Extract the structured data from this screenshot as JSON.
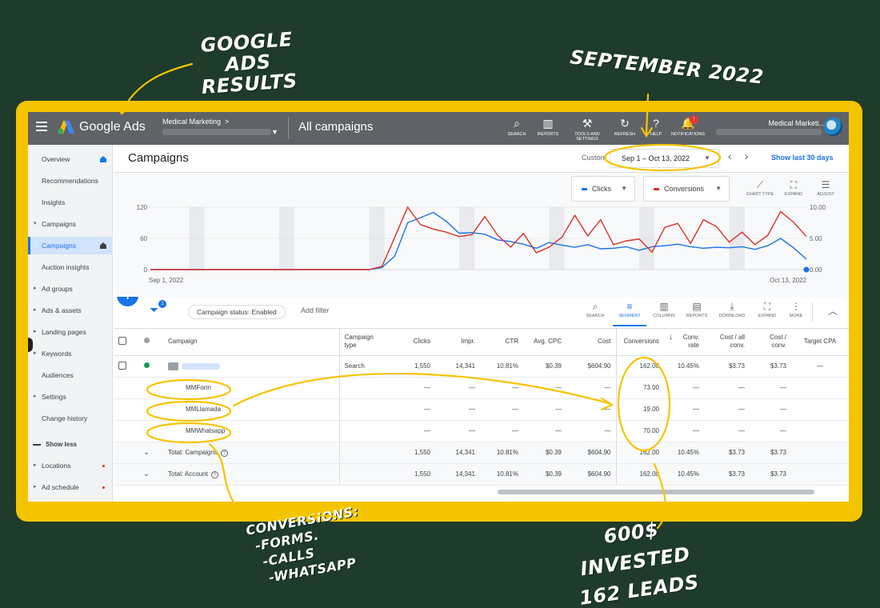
{
  "annotations": {
    "google_ads_results": [
      "GOOGLE ADS",
      "RESULTS"
    ],
    "september": "SEPTEMBER 2022",
    "conversions": [
      "CONVERSIONS:",
      "-FORMS.",
      "-CALLS",
      "-WHATSAPP"
    ],
    "invested": [
      "600$ INVESTED",
      "162 LEADS"
    ],
    "highlight_color": "#f5c400"
  },
  "topbar": {
    "brand": "Google Ads",
    "account": "Medical Marketing",
    "account_chevron": ">",
    "page": "All campaigns",
    "tools": [
      {
        "icon": "search-icon",
        "glyph": "⌕",
        "label": "SEARCH"
      },
      {
        "icon": "reports-icon",
        "glyph": "▥",
        "label": "REPORTS"
      },
      {
        "icon": "wrench-icon",
        "glyph": "⚒",
        "label": "TOOLS AND SETTINGS"
      },
      {
        "icon": "refresh-icon",
        "glyph": "↻",
        "label": "REFRESH"
      },
      {
        "icon": "help-icon",
        "glyph": "?",
        "label": "HELP"
      },
      {
        "icon": "bell-icon",
        "glyph": "🔔",
        "label": "NOTIFICATIONS"
      }
    ],
    "notification_count": "!",
    "user": "Medical Marketi..."
  },
  "sidebar": {
    "items": [
      {
        "label": "Overview",
        "style": "home"
      },
      {
        "label": "Recommendations",
        "style": ""
      },
      {
        "label": "Insights",
        "style": ""
      },
      {
        "label": "Campaigns",
        "style": "open"
      },
      {
        "label": "Campaigns",
        "style": "active"
      },
      {
        "label": "Auction insights",
        "style": ""
      },
      {
        "label": "Ad groups",
        "style": "arrow"
      },
      {
        "label": "Ads & assets",
        "style": "arrow"
      },
      {
        "label": "Landing pages",
        "style": "arrow"
      },
      {
        "label": "Keywords",
        "style": "arrow"
      },
      {
        "label": "Audiences",
        "style": ""
      },
      {
        "label": "Settings",
        "style": "arrow"
      },
      {
        "label": "Change history",
        "style": ""
      }
    ],
    "show_less": "Show less",
    "more_items": [
      {
        "label": "Locations",
        "style": "arrow"
      },
      {
        "label": "Ad schedule",
        "style": "arrow"
      }
    ]
  },
  "header": {
    "title": "Campaigns",
    "custom_label": "Custom",
    "date_range": "Sep 1 – Oct 13, 2022",
    "show_last": "Show last 30 days"
  },
  "chart": {
    "metric1": {
      "label": "Clicks",
      "color": "#1a73e8"
    },
    "metric2": {
      "label": "Conversions",
      "color": "#d93025"
    },
    "tools": [
      {
        "icon": "chart-type-icon",
        "glyph": "⟋",
        "label": "CHART TYPE"
      },
      {
        "icon": "expand-icon",
        "glyph": "⛶",
        "label": "EXPAND"
      },
      {
        "icon": "adjust-icon",
        "glyph": "☰",
        "label": "ADJUST"
      }
    ]
  },
  "chart_data": {
    "type": "line",
    "x_start": "Sep 1, 2022",
    "x_end": "Oct 13, 2022",
    "y_left_ticks": [
      "120",
      "60",
      "0"
    ],
    "y_right_ticks": [
      "10.00",
      "5.00",
      "0.00"
    ],
    "ylim_left": [
      0,
      120
    ],
    "ylim_right": [
      0,
      10
    ],
    "series": [
      {
        "name": "Clicks",
        "axis": "left",
        "color": "#1a73e8",
        "values": [
          0,
          0,
          0,
          0,
          0,
          0,
          0,
          0,
          0,
          0,
          0,
          0,
          0,
          0,
          0,
          0,
          0,
          0,
          4,
          26,
          90,
          100,
          110,
          93,
          70,
          71,
          68,
          57,
          54,
          49,
          41,
          52,
          47,
          43,
          48,
          40,
          41,
          44,
          37,
          44,
          46,
          49,
          44,
          41,
          43,
          42,
          44,
          39,
          46,
          60,
          42,
          20
        ]
      },
      {
        "name": "Conversions",
        "axis": "right",
        "color": "#d93025",
        "values": [
          0,
          0,
          0,
          0,
          0,
          0,
          0,
          0,
          0,
          0,
          0,
          0,
          0,
          0,
          0,
          0,
          0,
          0,
          0.5,
          5.2,
          10.0,
          7.2,
          6.5,
          6.0,
          5.3,
          5.6,
          8.5,
          5.5,
          3.6,
          5.8,
          2.7,
          3.6,
          5.2,
          8.7,
          5.4,
          8.0,
          4.0,
          4.6,
          4.9,
          2.8,
          6.8,
          7.4,
          4.2,
          8.0,
          6.9,
          4.4,
          6.0,
          4.0,
          5.5,
          9.3,
          7.6,
          5.3
        ]
      }
    ]
  },
  "toolbar": {
    "filter_count": "1",
    "status_chip": "Campaign status: Enabled",
    "add_filter": "Add filter",
    "tools": [
      {
        "icon": "search-icon",
        "glyph": "⌕",
        "label": "SEARCH",
        "on": false
      },
      {
        "icon": "segment-icon",
        "glyph": "≡",
        "label": "SEGMENT",
        "on": true
      },
      {
        "icon": "columns-icon",
        "glyph": "▥",
        "label": "COLUMNS",
        "on": false
      },
      {
        "icon": "reports-icon",
        "glyph": "▤",
        "label": "REPORTS",
        "on": false
      },
      {
        "icon": "download-icon",
        "glyph": "⤓",
        "label": "DOWNLOAD",
        "on": false
      },
      {
        "icon": "expand-icon",
        "glyph": "⛶",
        "label": "EXPAND",
        "on": false
      },
      {
        "icon": "more-icon",
        "glyph": "⋮",
        "label": "MORE",
        "on": false
      }
    ],
    "collapse_glyph": "︿"
  },
  "table": {
    "headers": [
      "Campaign",
      "Campaign type",
      "Clicks",
      "Impr.",
      "CTR",
      "Avg. CPC",
      "Cost",
      "Conversions",
      "Conv. rate",
      "Cost / all conv.",
      "Cost / conv.",
      "Target CPA"
    ],
    "campaign_row": [
      "Search",
      "1,550",
      "14,341",
      "10.81%",
      "$0.39",
      "$604.90",
      "162.00",
      "10.45%",
      "$3.73",
      "$3.73",
      "—"
    ],
    "segments": [
      {
        "name": "MMForm",
        "conv": "73.00"
      },
      {
        "name": "MMLlamada",
        "conv": "19.00"
      },
      {
        "name": "MMWhatsapp",
        "conv": "70.00"
      }
    ],
    "dash": "—",
    "totals": [
      {
        "label": "Total: Campaigns",
        "values": [
          "1,550",
          "14,341",
          "10.81%",
          "$0.39",
          "$604.90",
          "162.00",
          "10.45%",
          "$3.73",
          "$3.73"
        ]
      },
      {
        "label": "Total: Account",
        "values": [
          "1,550",
          "14,341",
          "10.81%",
          "$0.39",
          "$604.90",
          "162.00",
          "10.45%",
          "$3.73",
          "$3.73"
        ]
      }
    ]
  }
}
